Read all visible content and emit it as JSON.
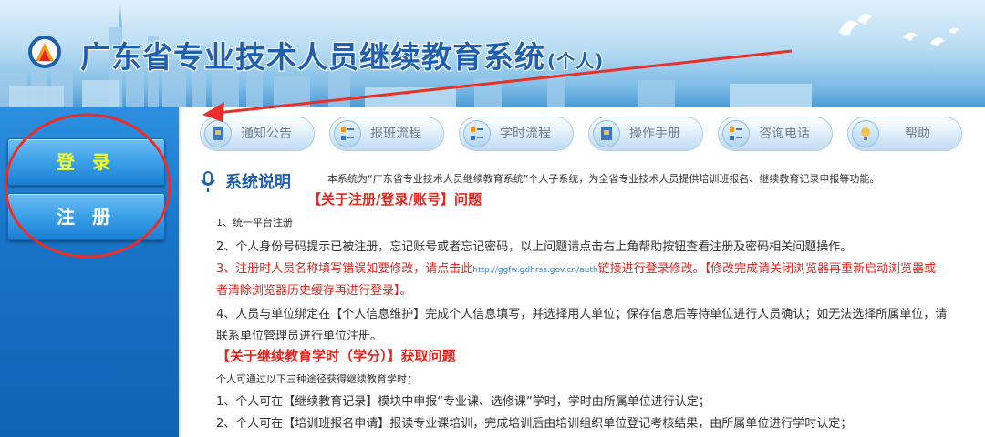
{
  "banner": {
    "title": "广东省专业技术人员继续教育系统",
    "title_suffix": "(个人)"
  },
  "sidebar": {
    "login_label": "登 录",
    "register_label": "注 册"
  },
  "menu": {
    "items": [
      {
        "label": "通知公告",
        "icon": "notice-icon"
      },
      {
        "label": "报班流程",
        "icon": "flow-icon"
      },
      {
        "label": "学时流程",
        "icon": "flow-icon"
      },
      {
        "label": "操作手册",
        "icon": "manual-icon"
      },
      {
        "label": "咨询电话",
        "icon": "phone-list-icon"
      },
      {
        "label": "帮助",
        "icon": "lightbulb-icon"
      }
    ]
  },
  "system": {
    "title": "系统说明",
    "description": "本系统为“广东省专业技术人员继续教育系统”个人子系统，为全省专业技术人员提供培训班报名、继续教育记录申报等功能。"
  },
  "content": {
    "section1_title": "【关于注册/登录/账号】问题",
    "line1": "1、统一平台注册",
    "line2": "2、个人身份号码提示已被注册，忘记账号或者忘记密码，以上问题请点击右上角帮助按钮查看注册及密码相关问题操作。",
    "line3_prefix": "3、注册时人员名称填写错误如要修改，请点击此",
    "line3_url": "http://ggfw.gdhrss.gov.cn/auth",
    "line3_suffix": "链接进行登录修改。【修改完成请关闭浏览器再重新启动浏览器或",
    "line3_cont": "者清除浏览器历史缓存再进行登录】。",
    "line4": "4、人员与单位绑定在【个人信息维护】完成个人信息填写，并选择用人单位；保存信息后等待单位进行人员确认；如无法选择所属单位，请",
    "line4_cont": "联系单位管理员进行单位注册。",
    "section2_title": "【关于继续教育学时（学分）】获取问题",
    "line5": "个人可通过以下三种途径获得继续教育学时；",
    "line6": "1、个人可在【继续教育记录】模块中申报“专业课、选修课”学时，学时由所属单位进行认定；",
    "line7": "2、个人可在【培训班报名申请】报读专业课培训，完成培训后由培训组织单位登记考核结果，由所属单位进行学时认定；"
  },
  "colors": {
    "title_blue": "#1f5fb0",
    "alert_red": "#e0261e",
    "sidebar_blue": "#1874c8",
    "login_yellow": "#f4ff30",
    "annotation_red": "#e8302a"
  }
}
